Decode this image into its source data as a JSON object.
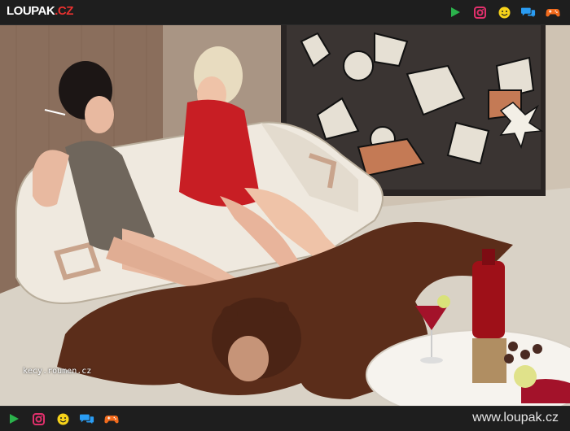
{
  "header": {
    "logo_main": "LOUPAK",
    "logo_tld": ".CZ",
    "icons": [
      "play-icon",
      "instagram-icon",
      "smiley-icon",
      "chat-icon",
      "gamepad-icon"
    ]
  },
  "image": {
    "watermark": "kecy.roumen.cz"
  },
  "footer": {
    "site_url": "www.loupak.cz",
    "icons": [
      "play-icon",
      "instagram-icon",
      "smiley-icon",
      "chat-icon",
      "gamepad-icon"
    ]
  },
  "colors": {
    "bar_bg": "#1e1e1e",
    "accent_red": "#e8312f",
    "play_green": "#2bb24c",
    "instagram_red": "#e1306c",
    "smiley_yellow": "#f7d31a",
    "chat_blue": "#2a9df4",
    "gamepad_orange": "#f26b1d"
  }
}
